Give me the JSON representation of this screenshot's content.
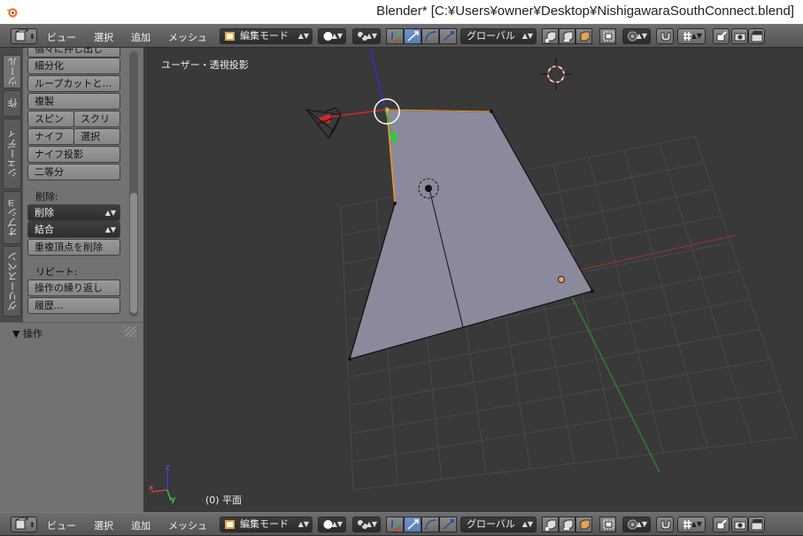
{
  "window": {
    "title": "Blender* [C:¥Users¥owner¥Desktop¥NishigawaraSouthConnect.blend]"
  },
  "header_top": {
    "menus": [
      "ビュー",
      "選択",
      "追加",
      "メッシュ"
    ],
    "mode": "編集モード",
    "orientation": "グローバル"
  },
  "header_bottom": {
    "menus": [
      "ビュー",
      "選択",
      "追加",
      "メッシュ"
    ],
    "mode": "編集モード",
    "orientation": "グローバル"
  },
  "tool_tabs": [
    "ツール",
    "作",
    "シェーディ",
    "オプショ",
    "グリースペン"
  ],
  "tool_panel": {
    "buttons": [
      "個々に押し出し",
      "細分化",
      "ループカットと…",
      "複製"
    ],
    "row1": [
      "スピン",
      "スクリ"
    ],
    "row2": [
      "ナイフ",
      "選択"
    ],
    "buttons2": [
      "ナイフ投影",
      "二等分"
    ],
    "delete_label": "削除:",
    "delete_select": "削除",
    "merge_select": "結合",
    "remove_doubles": "重複頂点を削除",
    "repeat_label": "リピート:",
    "repeat_last": "操作の繰り返し",
    "history": "履歴..."
  },
  "operator_panel": {
    "title": "▼ 操作"
  },
  "viewport": {
    "view_label": "ユーザー・透視投影",
    "object_label": "(0) 平面"
  },
  "colors": {
    "header": "#5f5f5f",
    "panel": "#727272",
    "viewport": "#393939",
    "mesh_face": "#8a8a9c",
    "selected_edge": "#ff9a1a",
    "axis_x": "#d23c3c",
    "axis_y": "#3cb43c",
    "axis_z": "#3c3cd2",
    "active_blue": "#5a7fb5"
  }
}
